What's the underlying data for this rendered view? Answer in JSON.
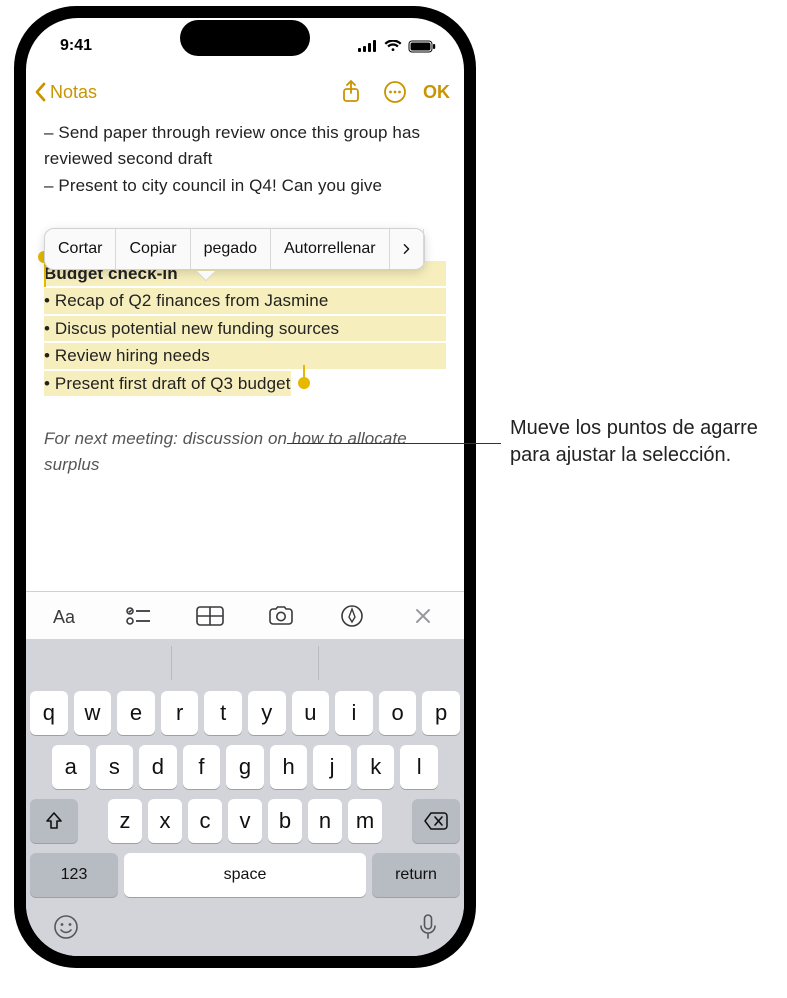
{
  "status": {
    "time": "9:41"
  },
  "nav": {
    "back_label": "Notas",
    "done_label": "OK"
  },
  "popover": {
    "cut": "Cortar",
    "copy": "Copiar",
    "paste": "pegado",
    "autofill": "Autorrellenar"
  },
  "note": {
    "line1": "– Send paper through review once this group has reviewed second draft",
    "line2": "– Present to city council in Q4! Can you give",
    "sel_title": "Budget check-in",
    "sel_b1": "• Recap of Q2 finances from Jasmine",
    "sel_b2": "• Discus potential new funding sources",
    "sel_b3": "• Review hiring needs",
    "sel_b4": "• Present first draft of Q3 budget",
    "next": "For next meeting: discussion on how to allocate surplus"
  },
  "keyboard": {
    "row1": [
      "q",
      "w",
      "e",
      "r",
      "t",
      "y",
      "u",
      "i",
      "o",
      "p"
    ],
    "row2": [
      "a",
      "s",
      "d",
      "f",
      "g",
      "h",
      "j",
      "k",
      "l"
    ],
    "row3": [
      "z",
      "x",
      "c",
      "v",
      "b",
      "n",
      "m"
    ],
    "numeric": "123",
    "space": "space",
    "return": "return"
  },
  "callout": "Mueve los puntos de agarre para ajustar la selección."
}
